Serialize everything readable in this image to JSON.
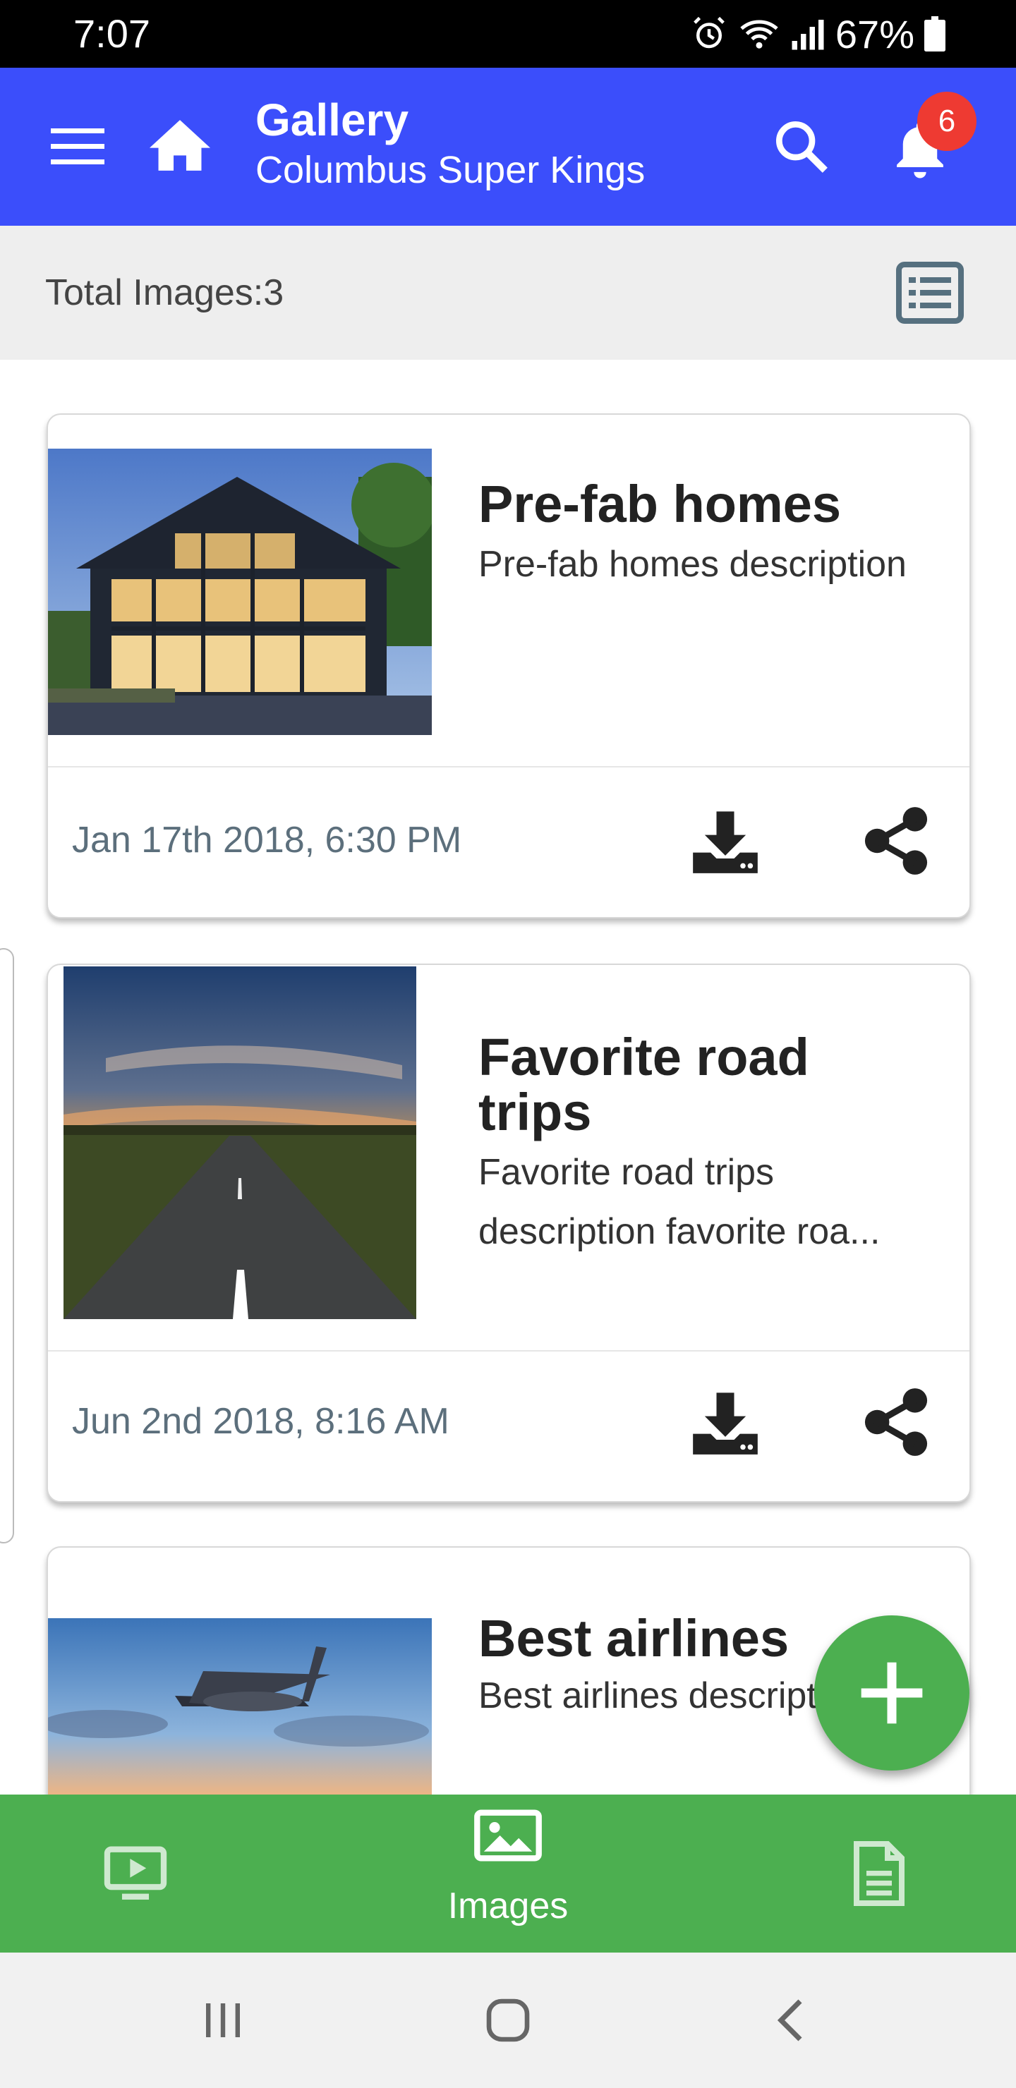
{
  "status_bar": {
    "time": "7:07",
    "battery": "67%"
  },
  "app_bar": {
    "title": "Gallery",
    "subtitle": "Columbus Super Kings",
    "notification_count": "6"
  },
  "summary": {
    "total_images_label": "Total Images:3"
  },
  "cards": [
    {
      "title": "Pre-fab homes",
      "description": "Pre-fab homes description",
      "date": "Jan 17th 2018, 6:30 PM",
      "image": "modern-glass-house-photo"
    },
    {
      "title": "Favorite road trips",
      "description": "Favorite road trips description favorite roa...",
      "date": "Jun 2nd 2018, 8:16 AM",
      "image": "road-sunset-photo"
    },
    {
      "title": "Best airlines",
      "description": "Best airlines description",
      "image": "airplane-sky-photo"
    }
  ],
  "bottom_nav": {
    "items": [
      {
        "icon": "video-icon",
        "label": ""
      },
      {
        "icon": "image-icon",
        "label": "Images"
      },
      {
        "icon": "document-icon",
        "label": ""
      }
    ],
    "active_index": 1
  },
  "colors": {
    "app_bar": "#3b4efb",
    "accent_green": "#4caf50",
    "badge": "#ee3a32",
    "date_text": "#5c6f7c"
  }
}
